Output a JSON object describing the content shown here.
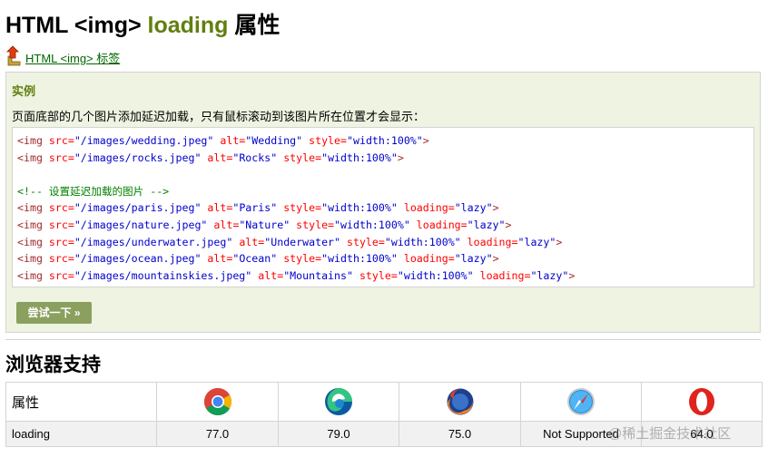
{
  "page": {
    "title_prefix": "HTML <img> ",
    "title_highlight": "loading",
    "title_suffix": " 属性"
  },
  "backlink": {
    "label": "HTML <img> 标签",
    "icon": "back-arrow-icon"
  },
  "example": {
    "heading": "实例",
    "description": "页面底部的几个图片添加延迟加载，只有鼠标滚动到该图片所在位置才会显示：",
    "code_lines": [
      {
        "src": "/images/wedding.jpeg",
        "alt": "Wedding",
        "style": "width:100%",
        "lazy": false
      },
      {
        "src": "/images/rocks.jpeg",
        "alt": "Rocks",
        "style": "width:100%",
        "lazy": false
      },
      {
        "blank": true
      },
      {
        "comment": "<!-- 设置延迟加载的图片 -->"
      },
      {
        "src": "/images/paris.jpeg",
        "alt": "Paris",
        "style": "width:100%",
        "lazy": true
      },
      {
        "src": "/images/nature.jpeg",
        "alt": "Nature",
        "style": "width:100%",
        "lazy": true
      },
      {
        "src": "/images/underwater.jpeg",
        "alt": "Underwater",
        "style": "width:100%",
        "lazy": true
      },
      {
        "src": "/images/ocean.jpeg",
        "alt": "Ocean",
        "style": "width:100%",
        "lazy": true
      },
      {
        "src": "/images/mountainskies.jpeg",
        "alt": "Mountains",
        "style": "width:100%",
        "lazy": true
      }
    ],
    "try_button": "尝试一下 »"
  },
  "support": {
    "section_title": "浏览器支持",
    "header_label": "属性",
    "browsers": [
      {
        "icon": "chrome-icon"
      },
      {
        "icon": "edge-icon"
      },
      {
        "icon": "firefox-icon"
      },
      {
        "icon": "safari-icon"
      },
      {
        "icon": "opera-icon"
      }
    ],
    "row": {
      "property": "loading",
      "values": [
        "77.0",
        "79.0",
        "75.0",
        "Not Supported",
        "64.0"
      ]
    }
  },
  "watermark": "@稀土掘金技术社区",
  "colors": {
    "title_highlight": "#617f10",
    "link": "#006600",
    "example_bg": "#eef3e2",
    "button_bg": "#8ba05e",
    "not_supported": "#cc0000"
  }
}
